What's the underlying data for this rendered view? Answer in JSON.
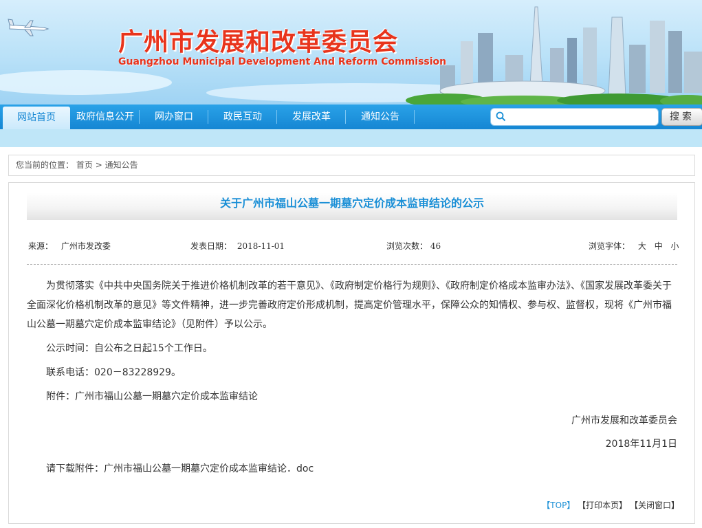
{
  "header": {
    "site_title": "广州市发展和改革委员会",
    "site_subtitle": "Guangzhou Municipal Development And Reform Commission"
  },
  "nav": {
    "items": [
      {
        "label": "网站首页"
      },
      {
        "label": "政府信息公开"
      },
      {
        "label": "网办窗口"
      },
      {
        "label": "政民互动"
      },
      {
        "label": "发展改革"
      },
      {
        "label": "通知公告"
      }
    ],
    "active_index": 0,
    "search_placeholder": "",
    "search_button": "搜索"
  },
  "breadcrumb": {
    "prefix": "您当前的位置：",
    "home": "首页",
    "sep": ">",
    "current": "通知公告"
  },
  "article": {
    "title": "关于广州市福山公墓一期墓穴定价成本监审结论的公示",
    "source_label": "来源：",
    "source_value": "广州市发改委",
    "date_label": "发表日期：",
    "date_value": "2018-11-01",
    "views_label": "浏览次数：",
    "views_value": "46",
    "font_label": "浏览字体：",
    "font_large": "大",
    "font_medium": "中",
    "font_small": "小",
    "body_paragraph": "为贯彻落实《中共中央国务院关于推进价格机制改革的若干意见》、《政府制定价格行为规则》、《政府制定价格成本监审办法》、《国家发展改革委关于全面深化价格机制改革的意见》等文件精神，进一步完善政府定价形成机制，提高定价管理水平，保障公众的知情权、参与权、监督权，现将《广州市福山公墓一期墓穴定价成本监审结论》（见附件）予以公示。",
    "period": "公示时间：自公布之日起15个工作日。",
    "phone": "联系电话：020－83228929。",
    "attachment": "附件：广州市福山公墓一期墓穴定价成本监审结论",
    "signer": "广州市发展和改革委员会",
    "sign_date": "2018年11月1日",
    "download_label": "请下载附件：",
    "download_file": "广州市福山公墓一期墓穴定价成本监审结论．doc"
  },
  "footer_links": {
    "top": "【TOP】",
    "print": "【打印本页】",
    "close": "【关闭窗口】"
  },
  "colors": {
    "nav_blue": "#1a8fd6",
    "title_red": "#e8341c",
    "title_blue": "#1a8fd6"
  }
}
